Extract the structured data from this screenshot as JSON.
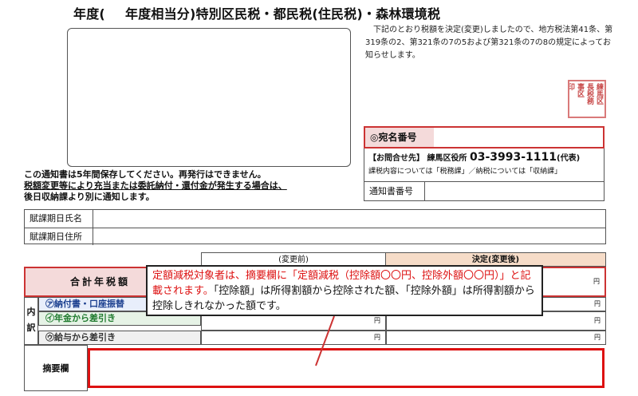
{
  "title": {
    "nendo": "年度(",
    "rest": "年度相当分)特別区民税・都民税(住民税)・森林環境税"
  },
  "notice": {
    "text": "下記のとおり税額を決定(変更)しましたので、地方税法第41条、第319条の2、第321条の7の5および第321条の7の8の規定によってお知らせします。"
  },
  "seal": {
    "chars": [
      "練馬区",
      "長税務",
      "事区",
      "印"
    ]
  },
  "atena": {
    "label": "◎宛名番号"
  },
  "contact": {
    "prefix": "【お問合せ先】 練馬区役所",
    "tel": "03-3993-1111",
    "tel_suffix": "(代表)",
    "line2": "課税内容については「税務課」／納税については「収納課」"
  },
  "tsuchi": {
    "label": "通知書番号"
  },
  "keep": {
    "line1": "この通知書は5年間保存してください。再発行はできません。",
    "line2": "税額変更等により充当または委託納付・還付金が発生する場合は、",
    "line3": "後日収納課より別に通知します。"
  },
  "fuka": {
    "name_label": "賦課期日氏名",
    "address_label": "賦課期日住所"
  },
  "table": {
    "before_header": "(変更前)",
    "after_header": "決定(変更後)",
    "total_label": "合計年税額",
    "yen": "円",
    "uchi_label": "内訳",
    "rows": [
      {
        "label": "㋐納付書・口座振替",
        "color": "#1b3f8f"
      },
      {
        "label": "㋑年金から差引き",
        "color": "#1f7a2e"
      },
      {
        "label": "㋒給与から差引き",
        "color": "#333333"
      }
    ],
    "tekiyo_label": "摘要欄"
  },
  "callout": {
    "red_text": "定額減税対象者は、摘要欄に「定額減税（控除額〇〇円、控除外額〇〇円）」と記載されます。",
    "black_text": "「控除額」は所得割額から控除された額、「控除外額」は所得割額から控除しきれなかった額です。"
  },
  "colors": {
    "accent_red": "#d11111",
    "label_pink": "#f4dada",
    "header_orange": "#f6dcc8"
  }
}
